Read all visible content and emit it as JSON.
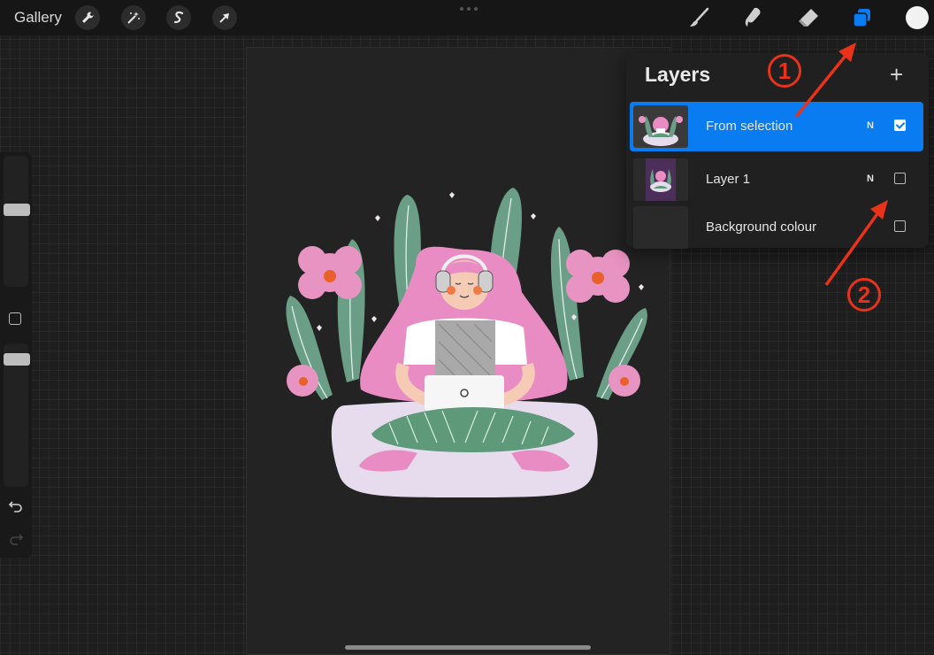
{
  "topbar": {
    "gallery_label": "Gallery",
    "left_tools": [
      "wrench-icon",
      "magic-wand-icon",
      "selection-s-icon",
      "transform-arrow-icon"
    ],
    "right_tools": [
      "brush-icon",
      "smudge-icon",
      "eraser-icon",
      "layers-icon",
      "color-swatch"
    ],
    "active_tool": "layers-icon",
    "accent_color": "#0a7cf2",
    "current_color": "#f2f2f2"
  },
  "layers_panel": {
    "title": "Layers",
    "add_label": "+",
    "layers": [
      {
        "name": "From selection",
        "blend": "N",
        "visible": true,
        "active": true
      },
      {
        "name": "Layer 1",
        "blend": "N",
        "visible": false,
        "active": false
      },
      {
        "name": "Background colour",
        "blend": "",
        "visible": false,
        "active": false
      }
    ]
  },
  "sidebar": {
    "controls": [
      "brush-size-slider",
      "modify-button",
      "opacity-slider",
      "undo-icon",
      "redo-icon"
    ]
  },
  "annotations": {
    "marker_1": "1",
    "marker_2": "2",
    "color": "#e8321a"
  }
}
